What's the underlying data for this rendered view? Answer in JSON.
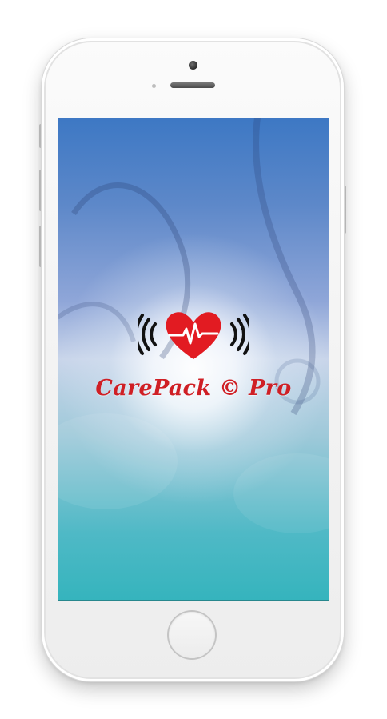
{
  "app": {
    "name": "CarePack © Pro"
  },
  "logo": {
    "icon": "heart-pulse-signal-icon",
    "heart_color": "#e21b22",
    "wave_color": "#111111"
  },
  "colors": {
    "brand_text": "#cf1f25",
    "screen_top": "#3d78c4",
    "screen_bottom": "#35b4bd"
  }
}
